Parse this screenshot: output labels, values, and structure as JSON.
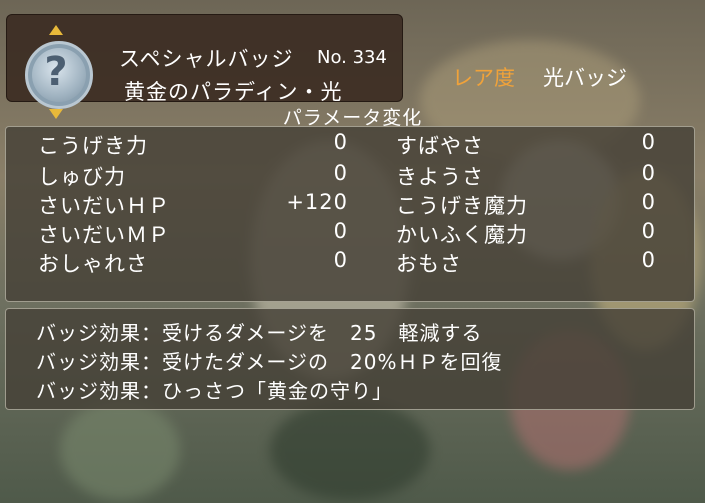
{
  "header": {
    "title": "スペシャルバッジ",
    "number": "No. 334",
    "subtitle": "黄金のパラディン・光",
    "rarity_label": "レア度",
    "rarity_value": "光バッジ"
  },
  "badge": {
    "icon": "question-mark-badge-icon",
    "symbol": "?"
  },
  "params": {
    "title": "パラメータ変化",
    "left": [
      {
        "name": "こうげき力",
        "value": "0"
      },
      {
        "name": "しゅび力",
        "value": "0"
      },
      {
        "name": "さいだいＨＰ",
        "value": "+120"
      },
      {
        "name": "さいだいＭＰ",
        "value": "0"
      },
      {
        "name": "おしゃれさ",
        "value": "0"
      }
    ],
    "right": [
      {
        "name": "すばやさ",
        "value": "0"
      },
      {
        "name": "きようさ",
        "value": "0"
      },
      {
        "name": "こうげき魔力",
        "value": "0"
      },
      {
        "name": "かいふく魔力",
        "value": "0"
      },
      {
        "name": "おもさ",
        "value": "0"
      }
    ]
  },
  "effects": [
    {
      "label": "バッジ効果：",
      "text": "受けるダメージを　25　軽減する"
    },
    {
      "label": "バッジ効果：",
      "text": "受けたダメージの　20%ＨＰを回復"
    },
    {
      "label": "バッジ効果：",
      "text": "ひっさつ「黄金の守り」"
    }
  ],
  "colors": {
    "rarity_label": "#f0a23a",
    "text": "#ffffff",
    "arrow": "#e8b93a"
  }
}
